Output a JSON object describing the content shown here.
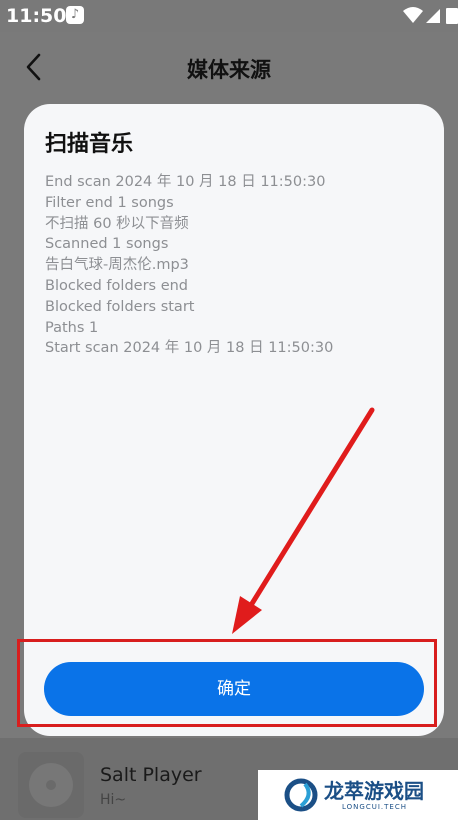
{
  "status_bar": {
    "time": "11:50",
    "notification_icon": "music-note-icon",
    "icons": [
      "wifi-icon",
      "signal-icon",
      "battery-icon"
    ]
  },
  "app_bar": {
    "back_icon": "chevron-left-icon",
    "title": "媒体来源"
  },
  "dialog": {
    "title": "扫描音乐",
    "log_lines": [
      "End scan 2024 年 10 月 18 日 11:50:30",
      "Filter end 1 songs",
      "不扫描 60 秒以下音频",
      "Scanned 1 songs",
      "告白气球-周杰伦.mp3",
      "Blocked folders end",
      "Blocked folders start",
      "Paths 1",
      "Start scan 2024 年 10 月 18 日 11:50:30"
    ],
    "confirm_label": "确定"
  },
  "player": {
    "title": "Salt Player",
    "subtitle": "Hi~"
  },
  "watermark": {
    "name_cn": "龙萃游戏园",
    "name_en": "LONGCUI.TECH"
  },
  "colors": {
    "accent": "#0a73e8",
    "highlight": "#d81e1e",
    "overlay": "#7a7a7a",
    "dialog_bg": "#f6f7f9"
  }
}
